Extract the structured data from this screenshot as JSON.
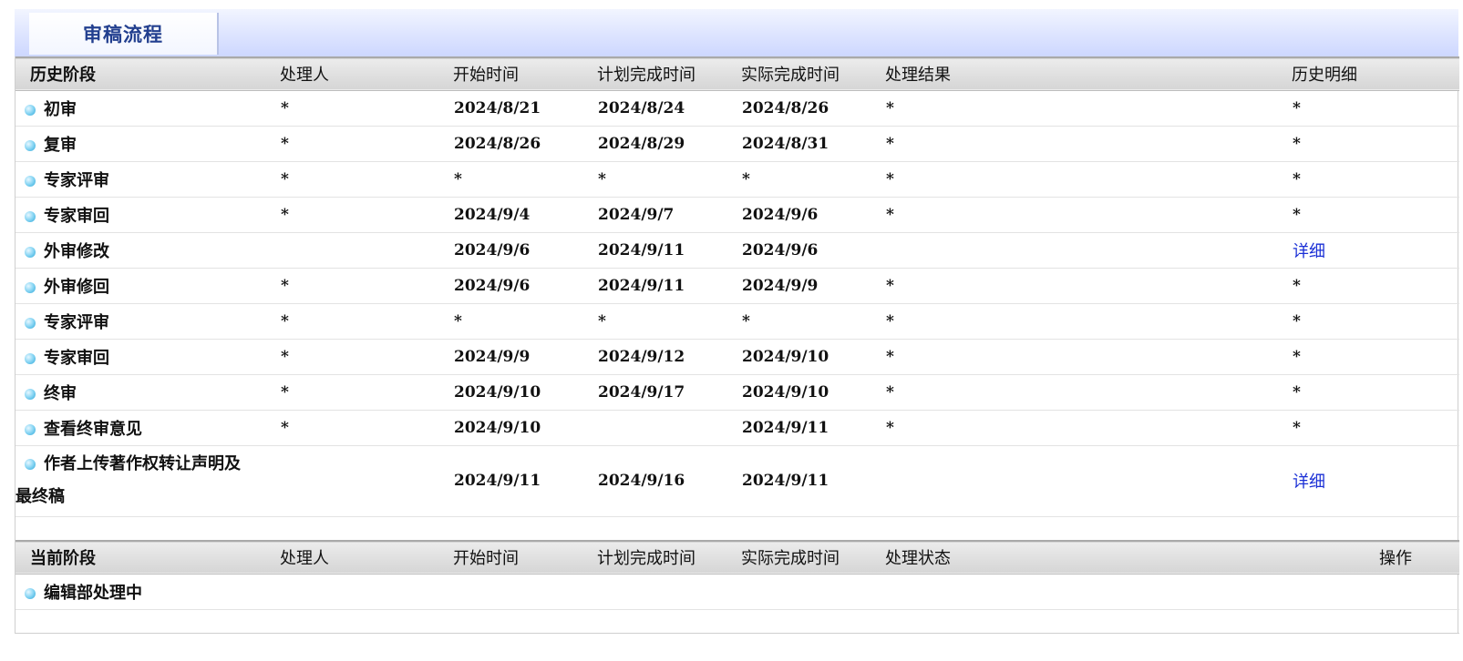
{
  "tab": {
    "title": "审稿流程"
  },
  "history": {
    "headers": [
      "历史阶段",
      "处理人",
      "开始时间",
      "计划完成时间",
      "实际完成时间",
      "处理结果",
      "历史明细"
    ],
    "rows": [
      {
        "stage": "初审",
        "handler": "*",
        "start": "2024/8/21",
        "plan": "2024/8/24",
        "actual": "2024/8/26",
        "result": "*",
        "detail": "*"
      },
      {
        "stage": "复审",
        "handler": "*",
        "start": "2024/8/26",
        "plan": "2024/8/29",
        "actual": "2024/8/31",
        "result": "*",
        "detail": "*"
      },
      {
        "stage": "专家评审",
        "handler": "*",
        "start": "*",
        "plan": "*",
        "actual": "*",
        "result": "*",
        "detail": "*"
      },
      {
        "stage": "专家审回",
        "handler": "*",
        "start": "2024/9/4",
        "plan": "2024/9/7",
        "actual": "2024/9/6",
        "result": "*",
        "detail": "*"
      },
      {
        "stage": "外审修改",
        "handler": "",
        "start": "2024/9/6",
        "plan": "2024/9/11",
        "actual": "2024/9/6",
        "result": "",
        "detail": "详细"
      },
      {
        "stage": "外审修回",
        "handler": "*",
        "start": "2024/9/6",
        "plan": "2024/9/11",
        "actual": "2024/9/9",
        "result": "*",
        "detail": "*"
      },
      {
        "stage": "专家评审",
        "handler": "*",
        "start": "*",
        "plan": "*",
        "actual": "*",
        "result": "*",
        "detail": "*"
      },
      {
        "stage": "专家审回",
        "handler": "*",
        "start": "2024/9/9",
        "plan": "2024/9/12",
        "actual": "2024/9/10",
        "result": "*",
        "detail": "*"
      },
      {
        "stage": "终审",
        "handler": "*",
        "start": "2024/9/10",
        "plan": "2024/9/17",
        "actual": "2024/9/10",
        "result": "*",
        "detail": "*"
      },
      {
        "stage": "查看终审意见",
        "handler": "*",
        "start": "2024/9/10",
        "plan": "",
        "actual": "2024/9/11",
        "result": "*",
        "detail": "*"
      },
      {
        "stage_line1": "作者上传著作权转让声明及",
        "stage_line2": "最终稿",
        "handler": "",
        "start": "2024/9/11",
        "plan": "2024/9/16",
        "actual": "2024/9/11",
        "result": "",
        "detail": "详细"
      }
    ]
  },
  "current": {
    "headers": [
      "当前阶段",
      "处理人",
      "开始时间",
      "计划完成时间",
      "实际完成时间",
      "处理状态",
      "操作"
    ],
    "rows": [
      {
        "stage": "编辑部处理中"
      }
    ]
  }
}
